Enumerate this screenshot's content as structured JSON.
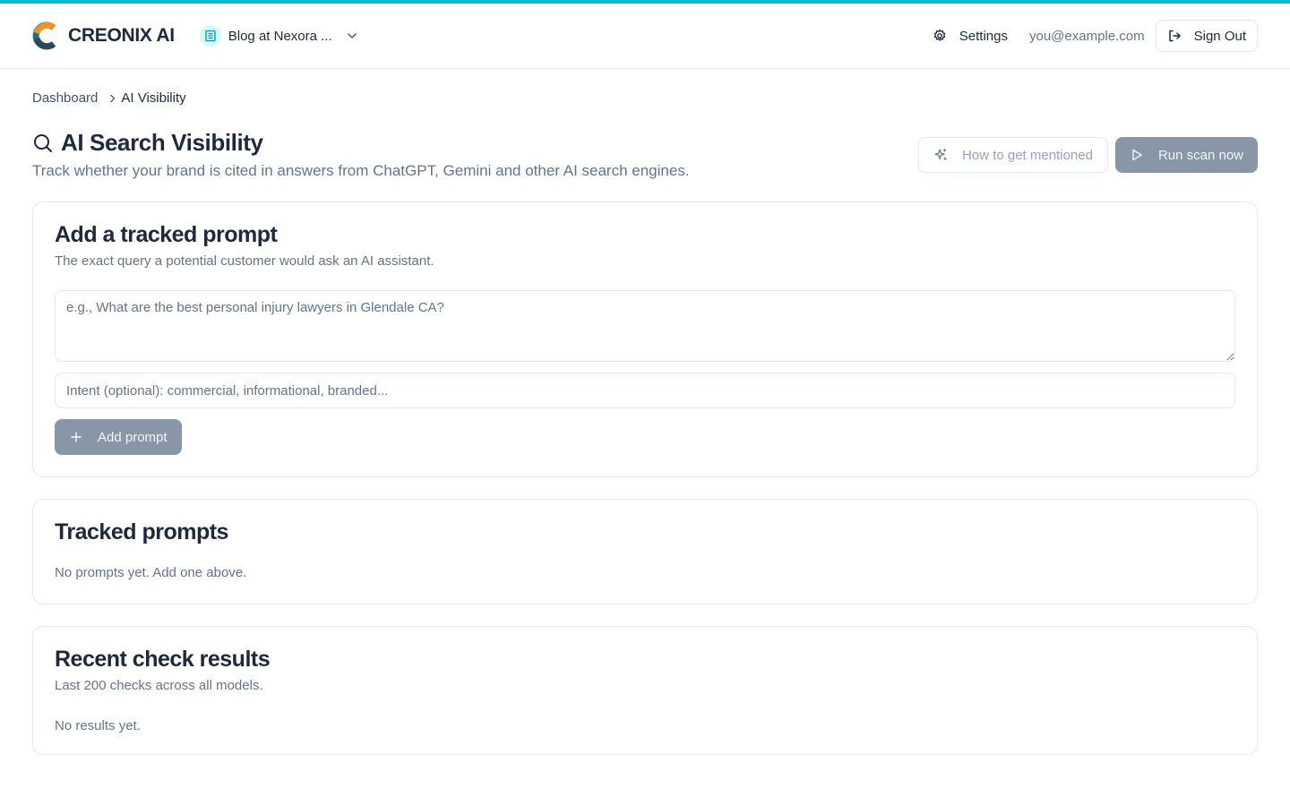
{
  "brand": {
    "name": "CREONIX AI"
  },
  "header": {
    "site_name": "Blog at Nexora ...",
    "settings_label": "Settings",
    "email": "you@example.com",
    "signout_label": "Sign Out"
  },
  "breadcrumb": {
    "parent": "Dashboard",
    "current": "AI Visibility"
  },
  "page": {
    "title": "AI Search Visibility",
    "subtitle": "Track whether your brand is cited in answers from ChatGPT, Gemini and other AI search engines.",
    "how_label": "How to get mentioned",
    "run_label": "Run scan now"
  },
  "add_card": {
    "title": "Add a tracked prompt",
    "description": "The exact query a potential customer would ask an AI assistant.",
    "prompt_value": "",
    "prompt_placeholder": "e.g., What are the best personal injury lawyers in Glendale CA?",
    "intent_value": "",
    "intent_placeholder": "Intent (optional): commercial, informational, branded...",
    "add_label": "Add prompt"
  },
  "tracked_card": {
    "title": "Tracked prompts",
    "empty": "No prompts yet. Add one above."
  },
  "results_card": {
    "title": "Recent check results",
    "description": "Last 200 checks across all models.",
    "empty": "No results yet."
  },
  "colors": {
    "accent": "#06b6d4",
    "disabled_button": "#8896a8",
    "text_primary": "#1e293b",
    "text_muted": "#64748b"
  }
}
